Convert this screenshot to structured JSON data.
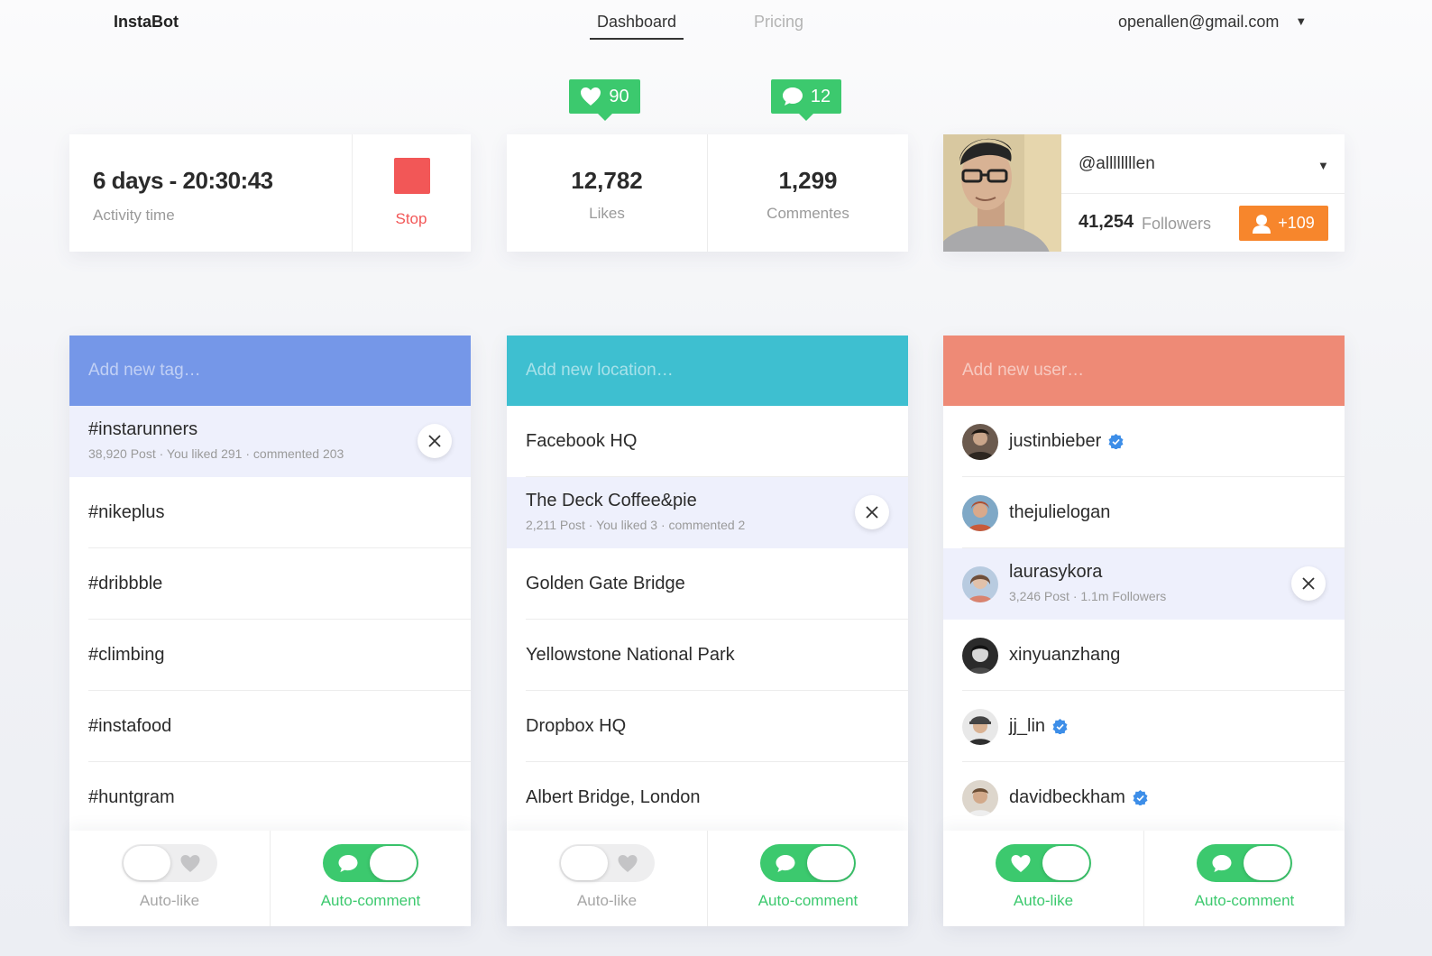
{
  "nav": {
    "brand": "InstaBot",
    "tabs": [
      {
        "label": "Dashboard",
        "active": true
      },
      {
        "label": "Pricing",
        "active": false
      }
    ],
    "account": "openallen@gmail.com"
  },
  "activity": {
    "time": "6 days - 20:30:43",
    "label": "Activity time",
    "stop_label": "Stop"
  },
  "stats": {
    "likes_badge": "90",
    "comments_badge": "12",
    "likes_value": "12,782",
    "likes_label": "Likes",
    "comments_value": "1,299",
    "comments_label": "Commentes"
  },
  "profile": {
    "username": "@allllllllen",
    "followers_count": "41,254",
    "followers_label": "Followers",
    "new_followers": "+109"
  },
  "tags": {
    "placeholder": "Add new tag…",
    "header_color": "#7597e8",
    "items": [
      {
        "title": "#instarunners",
        "sub": "38,920 Post · You liked 291 · commented 203",
        "selected": true
      },
      {
        "title": "#nikeplus"
      },
      {
        "title": "#dribbble"
      },
      {
        "title": "#climbing"
      },
      {
        "title": "#instafood"
      },
      {
        "title": "#huntgram"
      }
    ],
    "auto_like": {
      "label": "Auto-like",
      "on": false
    },
    "auto_comment": {
      "label": "Auto-comment",
      "on": true
    }
  },
  "locations": {
    "placeholder": "Add new location…",
    "header_color": "#3ebfd0",
    "items": [
      {
        "title": "Facebook HQ"
      },
      {
        "title": "The Deck Coffee&pie",
        "sub": "2,211 Post · You liked 3 · commented 2",
        "selected": true
      },
      {
        "title": "Golden Gate Bridge"
      },
      {
        "title": "Yellowstone National Park"
      },
      {
        "title": "Dropbox HQ"
      },
      {
        "title": "Albert Bridge, London"
      }
    ],
    "auto_like": {
      "label": "Auto-like",
      "on": false
    },
    "auto_comment": {
      "label": "Auto-comment",
      "on": true
    }
  },
  "users": {
    "placeholder": "Add new user…",
    "header_color": "#ee8a76",
    "items": [
      {
        "name": "justinbieber",
        "verified": true
      },
      {
        "name": "thejulielogan",
        "verified": false
      },
      {
        "name": "laurasykora",
        "sub": "3,246 Post · 1.1m Followers",
        "verified": false,
        "selected": true
      },
      {
        "name": "xinyuanzhang",
        "verified": false
      },
      {
        "name": "jj_lin",
        "verified": true
      },
      {
        "name": "davidbeckham",
        "verified": true
      }
    ],
    "auto_like": {
      "label": "Auto-like",
      "on": true
    },
    "auto_comment": {
      "label": "Auto-comment",
      "on": true
    }
  },
  "colors": {
    "accent_green": "#3cc96e",
    "stop_red": "#f25757",
    "follow_orange": "#f7862c",
    "verified_blue": "#3d8ee8"
  },
  "icons": [
    "heart-icon",
    "comment-icon",
    "close-icon",
    "user-icon",
    "verified-icon",
    "caret-down-icon"
  ]
}
